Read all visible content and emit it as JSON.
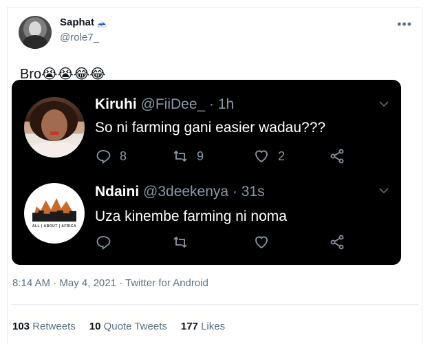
{
  "author": {
    "display_name": "Saphat",
    "badge_emoji": "🗻",
    "handle": "@role7_"
  },
  "tweet": {
    "text": "Bro",
    "emojis": "😭😭😂😂"
  },
  "screenshot": {
    "tweets": [
      {
        "name": "Kiruhi",
        "meta": "@FiiDee_ · 1h",
        "text": "So ni farming gani easier wadau???",
        "reply_count": "8",
        "retweet_count": "9",
        "like_count": "2"
      },
      {
        "name": "Ndaini",
        "meta": "@3deekenya · 31s",
        "text": "Uza kinembe farming ni noma",
        "logo_text": "ALL | ABOUT | AFRICA",
        "reply_count": "",
        "retweet_count": "",
        "like_count": ""
      }
    ]
  },
  "timestamp": {
    "time": "8:14 AM",
    "sep": " · ",
    "date": "May 4, 2021",
    "source": "Twitter for Android"
  },
  "stats": {
    "retweets_count": "103",
    "retweets_label": "Retweets",
    "quotes_count": "10",
    "quotes_label": "Quote Tweets",
    "likes_count": "177",
    "likes_label": "Likes"
  },
  "icons": {
    "more": "more-dots-icon",
    "reply": "reply-icon",
    "retweet": "retweet-icon",
    "like": "heart-icon",
    "share": "share-icon",
    "chevron": "chevron-down-icon"
  }
}
